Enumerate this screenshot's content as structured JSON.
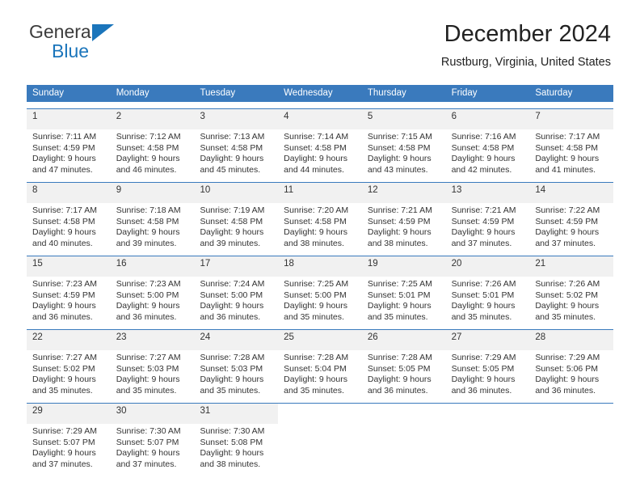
{
  "brand": {
    "line1": "General",
    "line2": "Blue",
    "triangle_color": "#1b75bb"
  },
  "header": {
    "title": "December 2024",
    "subtitle": "Rustburg, Virginia, United States",
    "header_bg": "#3a7abd",
    "daynum_bg": "#f1f1f1"
  },
  "weekdays": [
    "Sunday",
    "Monday",
    "Tuesday",
    "Wednesday",
    "Thursday",
    "Friday",
    "Saturday"
  ],
  "weeks": [
    [
      {
        "day": "1",
        "sunrise": "Sunrise: 7:11 AM",
        "sunset": "Sunset: 4:59 PM",
        "daylight1": "Daylight: 9 hours",
        "daylight2": "and 47 minutes."
      },
      {
        "day": "2",
        "sunrise": "Sunrise: 7:12 AM",
        "sunset": "Sunset: 4:58 PM",
        "daylight1": "Daylight: 9 hours",
        "daylight2": "and 46 minutes."
      },
      {
        "day": "3",
        "sunrise": "Sunrise: 7:13 AM",
        "sunset": "Sunset: 4:58 PM",
        "daylight1": "Daylight: 9 hours",
        "daylight2": "and 45 minutes."
      },
      {
        "day": "4",
        "sunrise": "Sunrise: 7:14 AM",
        "sunset": "Sunset: 4:58 PM",
        "daylight1": "Daylight: 9 hours",
        "daylight2": "and 44 minutes."
      },
      {
        "day": "5",
        "sunrise": "Sunrise: 7:15 AM",
        "sunset": "Sunset: 4:58 PM",
        "daylight1": "Daylight: 9 hours",
        "daylight2": "and 43 minutes."
      },
      {
        "day": "6",
        "sunrise": "Sunrise: 7:16 AM",
        "sunset": "Sunset: 4:58 PM",
        "daylight1": "Daylight: 9 hours",
        "daylight2": "and 42 minutes."
      },
      {
        "day": "7",
        "sunrise": "Sunrise: 7:17 AM",
        "sunset": "Sunset: 4:58 PM",
        "daylight1": "Daylight: 9 hours",
        "daylight2": "and 41 minutes."
      }
    ],
    [
      {
        "day": "8",
        "sunrise": "Sunrise: 7:17 AM",
        "sunset": "Sunset: 4:58 PM",
        "daylight1": "Daylight: 9 hours",
        "daylight2": "and 40 minutes."
      },
      {
        "day": "9",
        "sunrise": "Sunrise: 7:18 AM",
        "sunset": "Sunset: 4:58 PM",
        "daylight1": "Daylight: 9 hours",
        "daylight2": "and 39 minutes."
      },
      {
        "day": "10",
        "sunrise": "Sunrise: 7:19 AM",
        "sunset": "Sunset: 4:58 PM",
        "daylight1": "Daylight: 9 hours",
        "daylight2": "and 39 minutes."
      },
      {
        "day": "11",
        "sunrise": "Sunrise: 7:20 AM",
        "sunset": "Sunset: 4:58 PM",
        "daylight1": "Daylight: 9 hours",
        "daylight2": "and 38 minutes."
      },
      {
        "day": "12",
        "sunrise": "Sunrise: 7:21 AM",
        "sunset": "Sunset: 4:59 PM",
        "daylight1": "Daylight: 9 hours",
        "daylight2": "and 38 minutes."
      },
      {
        "day": "13",
        "sunrise": "Sunrise: 7:21 AM",
        "sunset": "Sunset: 4:59 PM",
        "daylight1": "Daylight: 9 hours",
        "daylight2": "and 37 minutes."
      },
      {
        "day": "14",
        "sunrise": "Sunrise: 7:22 AM",
        "sunset": "Sunset: 4:59 PM",
        "daylight1": "Daylight: 9 hours",
        "daylight2": "and 37 minutes."
      }
    ],
    [
      {
        "day": "15",
        "sunrise": "Sunrise: 7:23 AM",
        "sunset": "Sunset: 4:59 PM",
        "daylight1": "Daylight: 9 hours",
        "daylight2": "and 36 minutes."
      },
      {
        "day": "16",
        "sunrise": "Sunrise: 7:23 AM",
        "sunset": "Sunset: 5:00 PM",
        "daylight1": "Daylight: 9 hours",
        "daylight2": "and 36 minutes."
      },
      {
        "day": "17",
        "sunrise": "Sunrise: 7:24 AM",
        "sunset": "Sunset: 5:00 PM",
        "daylight1": "Daylight: 9 hours",
        "daylight2": "and 36 minutes."
      },
      {
        "day": "18",
        "sunrise": "Sunrise: 7:25 AM",
        "sunset": "Sunset: 5:00 PM",
        "daylight1": "Daylight: 9 hours",
        "daylight2": "and 35 minutes."
      },
      {
        "day": "19",
        "sunrise": "Sunrise: 7:25 AM",
        "sunset": "Sunset: 5:01 PM",
        "daylight1": "Daylight: 9 hours",
        "daylight2": "and 35 minutes."
      },
      {
        "day": "20",
        "sunrise": "Sunrise: 7:26 AM",
        "sunset": "Sunset: 5:01 PM",
        "daylight1": "Daylight: 9 hours",
        "daylight2": "and 35 minutes."
      },
      {
        "day": "21",
        "sunrise": "Sunrise: 7:26 AM",
        "sunset": "Sunset: 5:02 PM",
        "daylight1": "Daylight: 9 hours",
        "daylight2": "and 35 minutes."
      }
    ],
    [
      {
        "day": "22",
        "sunrise": "Sunrise: 7:27 AM",
        "sunset": "Sunset: 5:02 PM",
        "daylight1": "Daylight: 9 hours",
        "daylight2": "and 35 minutes."
      },
      {
        "day": "23",
        "sunrise": "Sunrise: 7:27 AM",
        "sunset": "Sunset: 5:03 PM",
        "daylight1": "Daylight: 9 hours",
        "daylight2": "and 35 minutes."
      },
      {
        "day": "24",
        "sunrise": "Sunrise: 7:28 AM",
        "sunset": "Sunset: 5:03 PM",
        "daylight1": "Daylight: 9 hours",
        "daylight2": "and 35 minutes."
      },
      {
        "day": "25",
        "sunrise": "Sunrise: 7:28 AM",
        "sunset": "Sunset: 5:04 PM",
        "daylight1": "Daylight: 9 hours",
        "daylight2": "and 35 minutes."
      },
      {
        "day": "26",
        "sunrise": "Sunrise: 7:28 AM",
        "sunset": "Sunset: 5:05 PM",
        "daylight1": "Daylight: 9 hours",
        "daylight2": "and 36 minutes."
      },
      {
        "day": "27",
        "sunrise": "Sunrise: 7:29 AM",
        "sunset": "Sunset: 5:05 PM",
        "daylight1": "Daylight: 9 hours",
        "daylight2": "and 36 minutes."
      },
      {
        "day": "28",
        "sunrise": "Sunrise: 7:29 AM",
        "sunset": "Sunset: 5:06 PM",
        "daylight1": "Daylight: 9 hours",
        "daylight2": "and 36 minutes."
      }
    ],
    [
      {
        "day": "29",
        "sunrise": "Sunrise: 7:29 AM",
        "sunset": "Sunset: 5:07 PM",
        "daylight1": "Daylight: 9 hours",
        "daylight2": "and 37 minutes."
      },
      {
        "day": "30",
        "sunrise": "Sunrise: 7:30 AM",
        "sunset": "Sunset: 5:07 PM",
        "daylight1": "Daylight: 9 hours",
        "daylight2": "and 37 minutes."
      },
      {
        "day": "31",
        "sunrise": "Sunrise: 7:30 AM",
        "sunset": "Sunset: 5:08 PM",
        "daylight1": "Daylight: 9 hours",
        "daylight2": "and 38 minutes."
      },
      {
        "day": "",
        "sunrise": "",
        "sunset": "",
        "daylight1": "",
        "daylight2": ""
      },
      {
        "day": "",
        "sunrise": "",
        "sunset": "",
        "daylight1": "",
        "daylight2": ""
      },
      {
        "day": "",
        "sunrise": "",
        "sunset": "",
        "daylight1": "",
        "daylight2": ""
      },
      {
        "day": "",
        "sunrise": "",
        "sunset": "",
        "daylight1": "",
        "daylight2": ""
      }
    ]
  ]
}
